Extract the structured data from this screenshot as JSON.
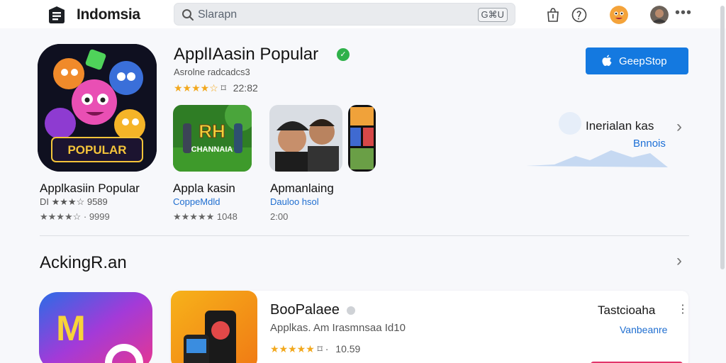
{
  "header": {
    "brand": "Indomsia",
    "search_placeholder": "Slarapn",
    "search_shortcut": "G⌘U"
  },
  "featured": {
    "title": "ApplIAasin Popular",
    "subtitle": "Asrolne radcadcs3",
    "rating_stars": "★★★★☆",
    "rating_count": "22:82",
    "get_button": "GeepStop",
    "promo_title": "Inerialan kas",
    "promo_link": "Bnnois"
  },
  "featured_apps": [
    {
      "title": "Applkasiin Popular",
      "sub": "DI ★★★☆ 9589",
      "meta": "★★★★☆ · 9999"
    },
    {
      "title": "Appla kasin",
      "sub": "CoppeMdld",
      "meta": "★★★★★ 1048"
    },
    {
      "title": "Apmanlaing",
      "sub": "Dauloo hsol",
      "meta": "2:00"
    }
  ],
  "hero_icon_text": "POPULAR",
  "thumb1_text": "RH\nCHANNAIA",
  "section": {
    "title": "AckingR.an"
  },
  "bottom_card": {
    "title": "BooPalaee",
    "subtitle": "Applkas. Am Irasmnsaa Id10",
    "rating_stars": "★★★★★",
    "rating_count": "10.59",
    "right_title": "Tastcioaha",
    "right_link": "Vanbeanre"
  },
  "colors": {
    "accent": "#1479e0",
    "star": "#f2a81d",
    "link": "#1f6ed0",
    "verified": "#2fb14a"
  }
}
